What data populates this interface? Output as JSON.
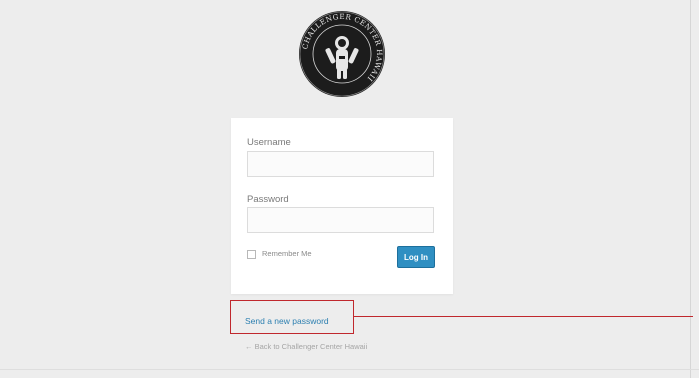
{
  "logo": {
    "text": "CHALLENGER CENTER HAWAII",
    "icon": "astronaut-seal-icon"
  },
  "login_form": {
    "username_label": "Username",
    "username_value": "",
    "password_label": "Password",
    "password_value": "",
    "remember_label": "Remember Me",
    "remember_checked": false,
    "submit_label": "Log In"
  },
  "links": {
    "lost_password": "Send a new password",
    "back_to_site": "← Back to Challenger Center Hawaii"
  },
  "annotation": {
    "color": "#c0282d"
  },
  "colors": {
    "background": "#ededed",
    "button": "#2f8fc2",
    "link": "#2c7fb0"
  }
}
